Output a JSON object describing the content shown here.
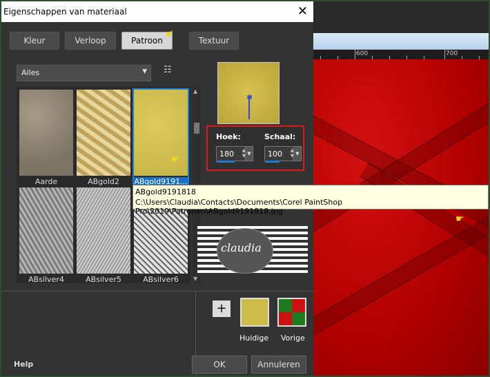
{
  "window": {
    "title": "Eigenschappen van materiaal",
    "close_glyph": "✕"
  },
  "tabs": [
    {
      "label": "Kleur",
      "active": false
    },
    {
      "label": "Verloop",
      "active": false
    },
    {
      "label": "Patroon",
      "active": true
    },
    {
      "label": "Textuur",
      "active": false
    }
  ],
  "category_dropdown": {
    "selected": "Alles"
  },
  "patterns": [
    {
      "label": "Aarde",
      "icon": "earth-pattern-thumb",
      "colors": [
        "#7d7466",
        "#a89b87"
      ]
    },
    {
      "label": "ABgold2",
      "icon": "gold-wave-pattern-thumb",
      "colors": [
        "#bfa25b",
        "#e8d79a"
      ]
    },
    {
      "label": "ABgold9191...",
      "icon": "gold-speckle-pattern-thumb",
      "colors": [
        "#c6b446",
        "#dccb5c"
      ],
      "selected": true
    },
    {
      "label": "ABsilver4",
      "icon": "silver-pattern-thumb",
      "colors": [
        "#7a7a7a",
        "#b5b5b5"
      ]
    },
    {
      "label": "ABsilver5",
      "icon": "silver-pattern-thumb",
      "colors": [
        "#9a9a9a",
        "#d0d0d0"
      ]
    },
    {
      "label": "ABsilver6",
      "icon": "silver-ornament-pattern-thumb",
      "colors": [
        "#555555",
        "#e0e0e0"
      ]
    }
  ],
  "controls": {
    "angle_label": "Hoek:",
    "angle_value": "180",
    "angle_fraction": 0.5,
    "scale_label": "Schaal:",
    "scale_value": "100",
    "scale_fraction": 0.4
  },
  "tooltip": {
    "name": "ABgold9191818",
    "path": "C:\\Users\\Claudia\\Contacts\\Documents\\Corel PaintShop Pro\\2019\\Patronen\\ABgold9191818.jpg"
  },
  "logo": {
    "text": "claudia"
  },
  "swatches": {
    "current_label": "Huidige",
    "previous_label": "Vorige",
    "current_color": "#cdbb4a",
    "previous_colors": [
      "#1e7a1e",
      "#cc1111"
    ]
  },
  "add_button_glyph": "+",
  "footer": {
    "help_label": "Help",
    "ok_label": "OK",
    "cancel_label": "Annuleren"
  },
  "ruler": {
    "labels": [
      "600",
      "700"
    ]
  },
  "pointer_glyph": "☛"
}
